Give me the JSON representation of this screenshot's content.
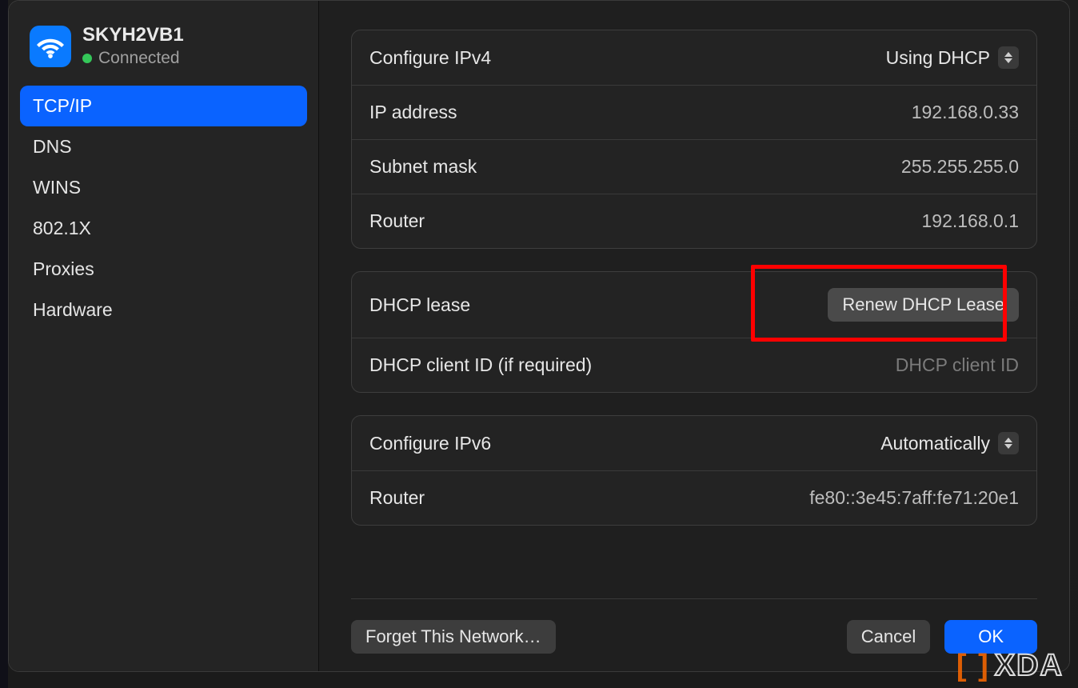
{
  "network": {
    "name": "SKYH2VB1",
    "status": "Connected"
  },
  "sidebar": {
    "items": [
      {
        "label": "TCP/IP",
        "selected": true
      },
      {
        "label": "DNS",
        "selected": false
      },
      {
        "label": "WINS",
        "selected": false
      },
      {
        "label": "802.1X",
        "selected": false
      },
      {
        "label": "Proxies",
        "selected": false
      },
      {
        "label": "Hardware",
        "selected": false
      }
    ]
  },
  "ipv4": {
    "configure_label": "Configure IPv4",
    "configure_value": "Using DHCP",
    "ip_label": "IP address",
    "ip_value": "192.168.0.33",
    "subnet_label": "Subnet mask",
    "subnet_value": "255.255.255.0",
    "router_label": "Router",
    "router_value": "192.168.0.1"
  },
  "dhcp": {
    "lease_label": "DHCP lease",
    "renew_button": "Renew DHCP Lease",
    "client_id_label": "DHCP client ID (if required)",
    "client_id_placeholder": "DHCP client ID"
  },
  "ipv6": {
    "configure_label": "Configure IPv6",
    "configure_value": "Automatically",
    "router_label": "Router",
    "router_value": "fe80::3e45:7aff:fe71:20e1"
  },
  "footer": {
    "forget": "Forget This Network…",
    "cancel": "Cancel",
    "ok": "OK"
  },
  "watermark": "XDA"
}
